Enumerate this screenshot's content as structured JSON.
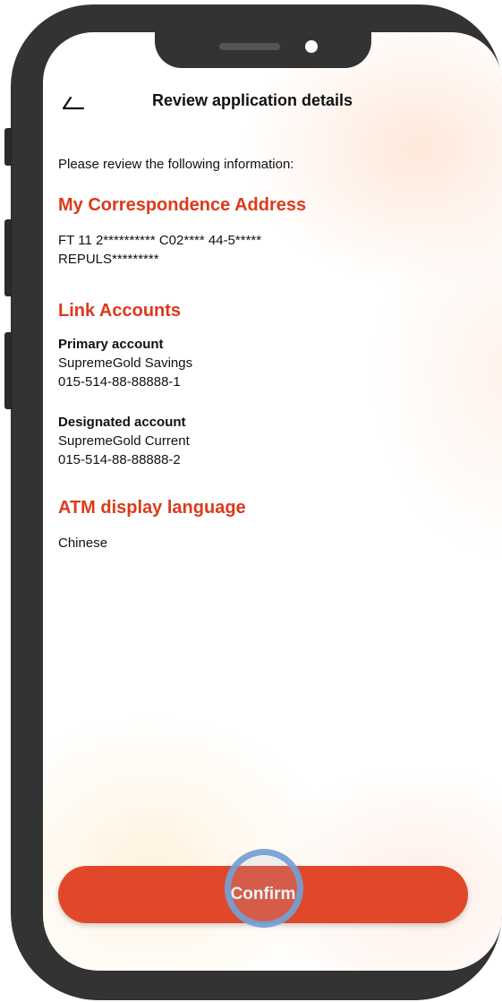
{
  "header": {
    "title": "Review application details",
    "back_icon": "back-arrow-icon"
  },
  "intro": "Please review the following information:",
  "address_section": {
    "title": "My Correspondence Address",
    "line1": "FT 11 2********** C02**** 44-5*****",
    "line2": "REPULS*********"
  },
  "link_accounts": {
    "title": "Link Accounts",
    "primary": {
      "label": "Primary account",
      "name": "SupremeGold Savings",
      "number": "015-514-88-88888-1"
    },
    "designated": {
      "label": "Designated account",
      "name": "SupremeGold Current",
      "number": "015-514-88-88888-2"
    }
  },
  "atm_language": {
    "title": "ATM display language",
    "value": "Chinese"
  },
  "actions": {
    "confirm_label": "Confirm"
  },
  "colors": {
    "accent": "#db3a1c",
    "button": "#e1482a",
    "frame": "#333333",
    "tap_indicator": "#74a0d2"
  }
}
